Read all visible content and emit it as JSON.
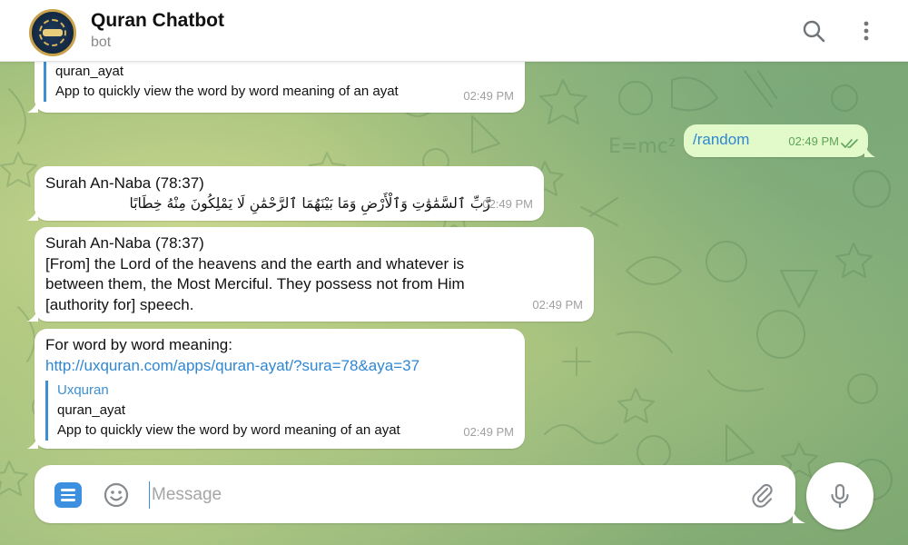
{
  "header": {
    "title": "Quran Chatbot",
    "subtitle": "bot",
    "avatar_icon": "quran-logo-icon",
    "search_icon": "search-icon",
    "menu_icon": "more-vertical-icon"
  },
  "messages": {
    "top_preview": {
      "title": "quran_ayat",
      "description": "App to quickly view the word by word meaning of an ayat",
      "time": "02:49 PM"
    },
    "outgoing": {
      "text": "/random",
      "time": "02:49 PM",
      "status_icon": "double-check-icon"
    },
    "arabic": {
      "heading": "Surah An-Naba (78:37)",
      "verse": "رَّبِّ ٱلسَّمَٰوَٰتِ وَٱلْأَرْضِ وَمَا بَيْنَهُمَا ٱلرَّحْمَٰنِ لَا يَمْلِكُونَ مِنْهُ خِطَابًا",
      "time": "02:49 PM"
    },
    "translation": {
      "heading": "Surah An-Naba (78:37)",
      "line1": "[From] the Lord of the heavens and the earth and whatever is",
      "line2": "between them, the Most Merciful. They possess not from Him",
      "line3": "[authority for] speech.",
      "time": "02:49 PM"
    },
    "word_meaning": {
      "intro": "For word by word meaning:",
      "link": "http://uxquran.com/apps/quran-ayat/?sura=78&aya=37",
      "preview_site": "Uxquran",
      "preview_title": "quran_ayat",
      "preview_description": "App to quickly view the word by word meaning of an ayat",
      "time": "02:49 PM"
    }
  },
  "composer": {
    "placeholder": "Message",
    "value": "",
    "menu_icon": "bot-menu-icon",
    "emoji_icon": "emoji-icon",
    "attach_icon": "paperclip-icon",
    "mic_icon": "microphone-icon"
  },
  "colors": {
    "accent": "#3d8fe0",
    "outgoing_bubble": "#e2fac9",
    "link": "#2f87d3"
  }
}
